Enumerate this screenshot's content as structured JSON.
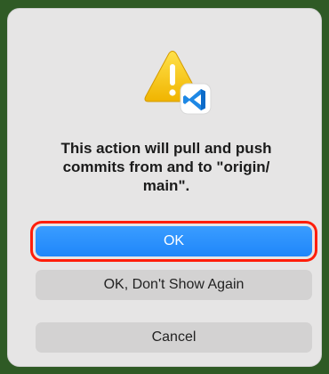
{
  "dialog": {
    "message": "This action will pull and push commits from and to \"origin/ main\".",
    "icons": {
      "warning": "warning-triangle-icon",
      "app": "vscode-app-icon"
    },
    "buttons": {
      "ok": "OK",
      "ok_dont_show": "OK, Don't Show Again",
      "cancel": "Cancel"
    },
    "colors": {
      "primary_button": "#1f86fa",
      "highlight_border": "#ff1e0a",
      "warning_yellow": "#f5c400",
      "vscode_blue": "#1e88e5",
      "background": "#2f5a25"
    }
  }
}
